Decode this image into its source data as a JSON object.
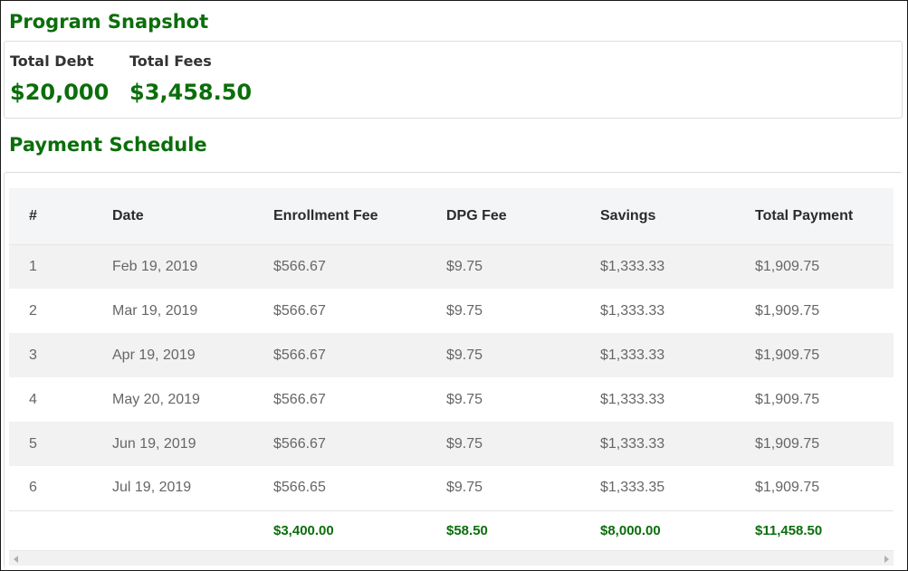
{
  "snapshot": {
    "title": "Program Snapshot",
    "total_debt_label": "Total Debt",
    "total_debt_value": "$20,000",
    "total_fees_label": "Total Fees",
    "total_fees_value": "$3,458.50"
  },
  "schedule": {
    "title": "Payment Schedule",
    "columns": [
      "#",
      "Date",
      "Enrollment Fee",
      "DPG Fee",
      "Savings",
      "Total Payment"
    ],
    "rows": [
      [
        "1",
        "Feb 19, 2019",
        "$566.67",
        "$9.75",
        "$1,333.33",
        "$1,909.75"
      ],
      [
        "2",
        "Mar 19, 2019",
        "$566.67",
        "$9.75",
        "$1,333.33",
        "$1,909.75"
      ],
      [
        "3",
        "Apr 19, 2019",
        "$566.67",
        "$9.75",
        "$1,333.33",
        "$1,909.75"
      ],
      [
        "4",
        "May 20, 2019",
        "$566.67",
        "$9.75",
        "$1,333.33",
        "$1,909.75"
      ],
      [
        "5",
        "Jun 19, 2019",
        "$566.67",
        "$9.75",
        "$1,333.33",
        "$1,909.75"
      ],
      [
        "6",
        "Jul 19, 2019",
        "$566.65",
        "$9.75",
        "$1,333.35",
        "$1,909.75"
      ]
    ],
    "totals": [
      "",
      "",
      "$3,400.00",
      "$58.50",
      "$8,000.00",
      "$11,458.50"
    ]
  },
  "colors": {
    "accent_green": "#0b6e0b",
    "header_bg": "#f4f5f7",
    "stripe_bg": "#f2f2f2"
  }
}
